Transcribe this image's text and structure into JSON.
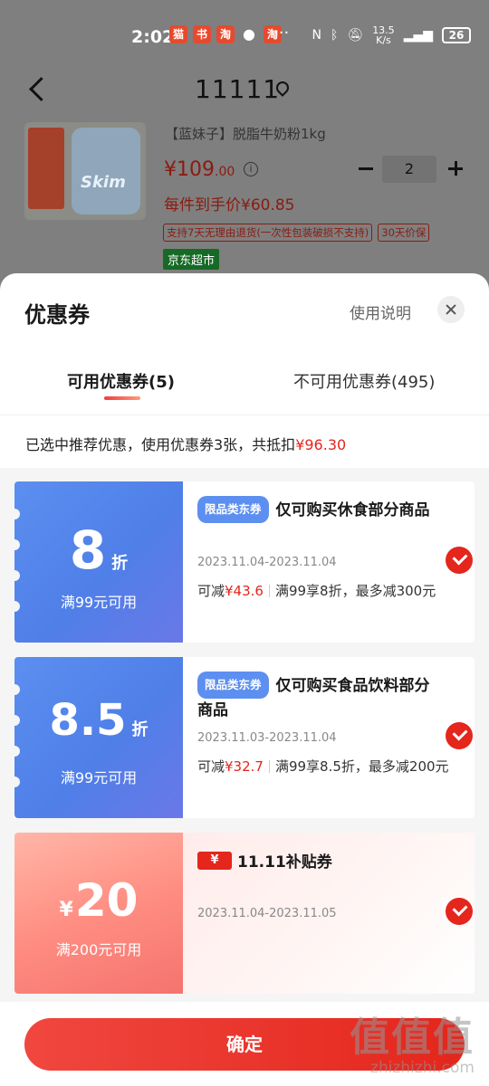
{
  "status_bar": {
    "time": "2:02",
    "notification_icons": [
      "tmall-icon",
      "xiaohongshu-icon",
      "taobao-icon",
      "qq-icon",
      "taobao-icon"
    ],
    "more": "···",
    "net_speed_value": "13.5",
    "net_speed_unit": "K/s",
    "battery": "26"
  },
  "header": {
    "address": "11111"
  },
  "product": {
    "title": "【蓝妹子】脱脂牛奶粉1kg",
    "image_label": "Skim",
    "price_main": "¥109",
    "price_decimal": ".00",
    "quantity": "2",
    "unit_price": "每件到手价¥60.85",
    "tags": [
      "支持7天无理由退货(一次性包装破损不支持)",
      "30天价保"
    ],
    "store_tag": "京东超市"
  },
  "sheet": {
    "title": "优惠券",
    "help_link": "使用说明",
    "tabs": [
      "可用优惠券(5)",
      "不可用优惠券(495)"
    ],
    "summary_prefix": "已选中推荐优惠，使用优惠券3张，共抵扣",
    "summary_amount": "¥96.30",
    "confirm_label": "确定"
  },
  "coupons": [
    {
      "amount": "8",
      "unit": "折",
      "condition": "满99元可用",
      "badge": "限品类东券",
      "name": "仅可购买休食部分商品",
      "dates": "2023.11.04-2023.11.04",
      "save_label": "可减",
      "save_amount": "¥43.6",
      "rule": "满99享8折，最多减300元"
    },
    {
      "amount": "8.5",
      "unit": "折",
      "condition": "满99元可用",
      "badge": "限品类东券",
      "name": "仅可购买食品饮料部分商品",
      "dates": "2023.11.03-2023.11.04",
      "save_label": "可减",
      "save_amount": "¥32.7",
      "rule": "满99享8.5折，最多减200元"
    },
    {
      "yen": "¥",
      "amount": "20",
      "condition": "满200元可用",
      "badge_symbol": "¥",
      "badge_text": "11.11补贴券",
      "dates": "2023.11.04-2023.11.05"
    }
  ],
  "watermark": {
    "logo": "值值值",
    "url": "zhizhizhi.com"
  },
  "colors": {
    "accent_red": "#e4261c",
    "coupon_blue": "#5c8ff0",
    "store_green": "#166a26"
  }
}
